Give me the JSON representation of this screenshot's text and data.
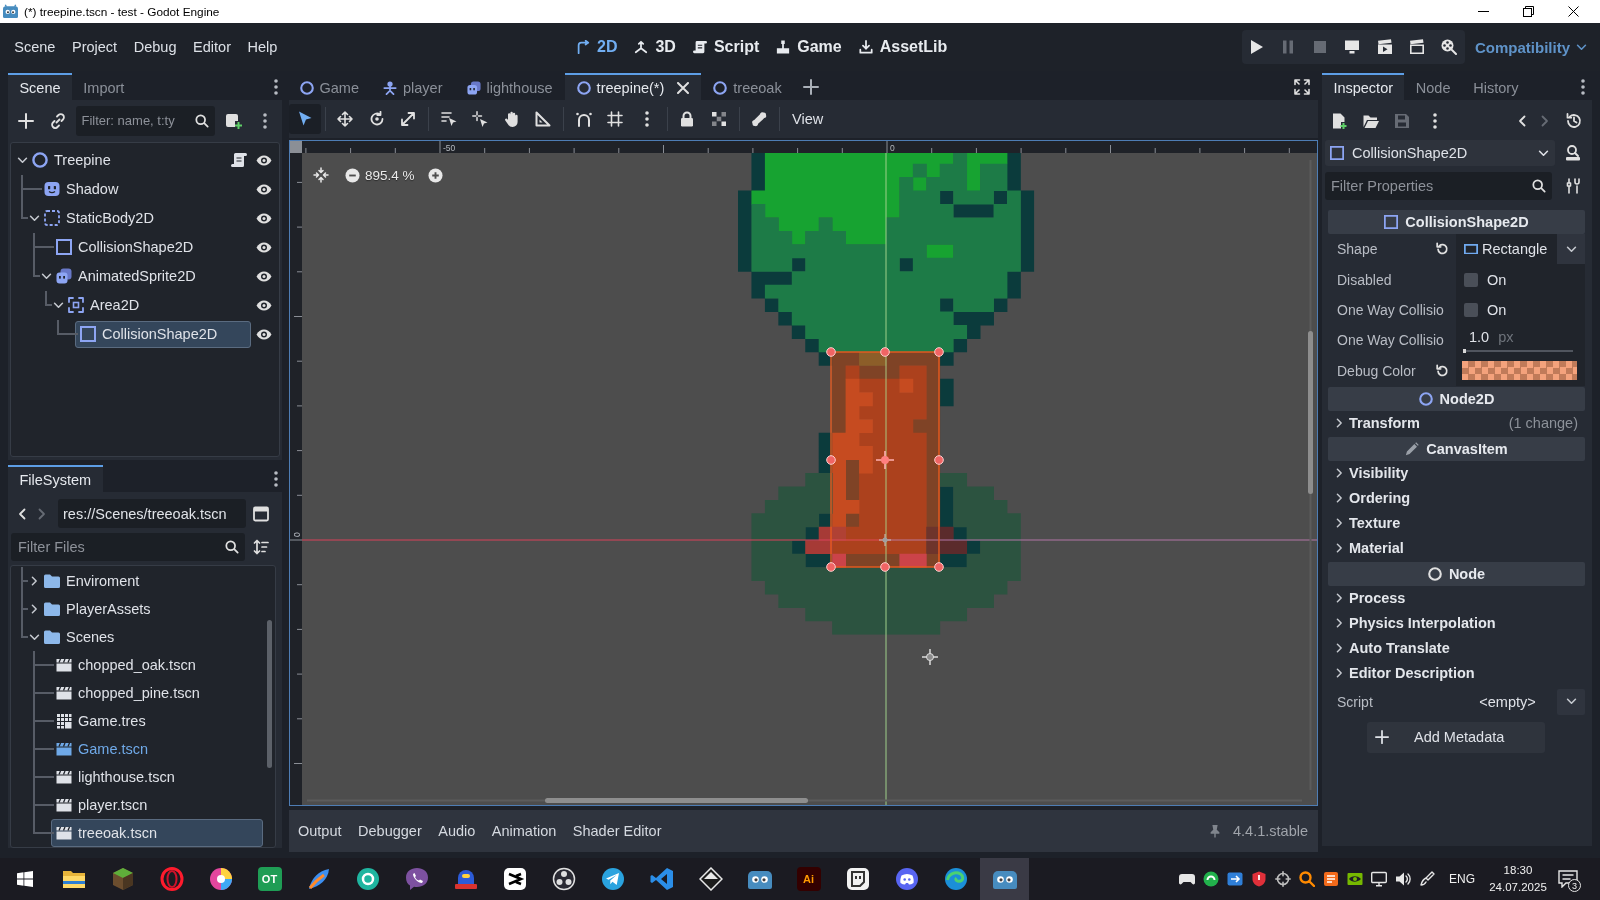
{
  "window": {
    "title": "(*) treepine.tscn - test - Godot Engine"
  },
  "menu": [
    "Scene",
    "Project",
    "Debug",
    "Editor",
    "Help"
  ],
  "workspaces": [
    {
      "label": "2D",
      "selected": true
    },
    {
      "label": "3D",
      "selected": false
    },
    {
      "label": "Script",
      "selected": false
    },
    {
      "label": "Game",
      "selected": false
    },
    {
      "label": "AssetLib",
      "selected": false
    }
  ],
  "run_buttons": [
    {
      "disabled": false
    },
    {
      "disabled": true
    },
    {
      "disabled": true
    },
    {
      "disabled": false
    },
    {
      "disabled": false
    },
    {
      "disabled": false
    },
    {
      "disabled": false
    }
  ],
  "renderer": {
    "label": "Compatibility"
  },
  "scene_dock": {
    "tabs": [
      {
        "label": "Scene",
        "selected": true
      },
      {
        "label": "Import",
        "selected": false
      }
    ],
    "filter": {
      "placeholder": "Filter: name, t:ty"
    },
    "tree": [
      {
        "name": "Treepine",
        "kind": "node2d",
        "expanded": true,
        "selected": false,
        "has_script": true,
        "visible": true,
        "children": [
          {
            "name": "Shadow",
            "kind": "sprite",
            "selected": false,
            "has_script": false,
            "visible": true
          },
          {
            "name": "StaticBody2D",
            "kind": "body",
            "expanded": true,
            "selected": false,
            "has_script": false,
            "visible": true,
            "children": [
              {
                "name": "CollisionShape2D",
                "kind": "shape",
                "selected": false,
                "has_script": false,
                "visible": true
              },
              {
                "name": "AnimatedSprite2D",
                "kind": "animated",
                "expanded": true,
                "selected": false,
                "has_script": false,
                "visible": true,
                "children": [
                  {
                    "name": "Area2D",
                    "kind": "area",
                    "expanded": true,
                    "selected": false,
                    "has_script": false,
                    "visible": true,
                    "children": [
                      {
                        "name": "CollisionShape2D",
                        "kind": "shape",
                        "selected": true,
                        "has_script": false,
                        "visible": true
                      }
                    ]
                  }
                ]
              }
            ]
          }
        ]
      }
    ]
  },
  "filesystem": {
    "tabs": [
      {
        "label": "FileSystem",
        "selected": true
      }
    ],
    "nav": [
      {
        "disabled": false
      },
      {
        "disabled": true
      }
    ],
    "path": "res://Scenes/treeoak.tscn",
    "filter": {
      "placeholder": "Filter Files"
    },
    "items": [
      {
        "name": "Enviroment",
        "kind": "folder",
        "expanded": false,
        "selected": false,
        "highlighted": false
      },
      {
        "name": "PlayerAssets",
        "kind": "folder",
        "expanded": false,
        "selected": false,
        "highlighted": false
      },
      {
        "name": "Scenes",
        "kind": "folder",
        "expanded": true,
        "selected": false,
        "highlighted": false,
        "children": [
          {
            "name": "chopped_oak.tscn",
            "kind": "scene",
            "selected": false,
            "highlighted": false
          },
          {
            "name": "chopped_pine.tscn",
            "kind": "scene",
            "selected": false,
            "highlighted": false
          },
          {
            "name": "Game.tres",
            "kind": "resource",
            "selected": false,
            "highlighted": false
          },
          {
            "name": "Game.tscn",
            "kind": "scene",
            "selected": false,
            "highlighted": true
          },
          {
            "name": "lighthouse.tscn",
            "kind": "scene",
            "selected": false,
            "highlighted": false
          },
          {
            "name": "player.tscn",
            "kind": "scene",
            "selected": false,
            "highlighted": false
          },
          {
            "name": "treeoak.tscn",
            "kind": "scene",
            "selected": true,
            "highlighted": false
          }
        ]
      }
    ]
  },
  "editor_tabs": [
    {
      "label": "Game",
      "kind": "node2d",
      "selected": false
    },
    {
      "label": "player",
      "kind": "character",
      "selected": false
    },
    {
      "label": "lighthouse",
      "kind": "animated",
      "selected": false
    },
    {
      "label": "treepine(*)",
      "kind": "node2d",
      "selected": true
    },
    {
      "label": "treeoak",
      "kind": "node2d",
      "selected": false
    }
  ],
  "canvas_toolbar": {
    "tools": [
      {
        "selected": true
      },
      {
        "selected": false
      },
      {
        "selected": false
      },
      {
        "selected": false
      },
      {
        "selected": false
      },
      {
        "selected": false
      },
      {
        "selected": false
      },
      {
        "selected": false
      },
      {
        "selected": false
      },
      {
        "selected": false
      },
      {
        "selected": false
      },
      {
        "selected": false
      },
      {
        "selected": false
      }
    ],
    "view_menu": "View"
  },
  "canvas": {
    "zoom": "895.4 %",
    "top_ruler": [
      "-50",
      "0"
    ],
    "left_ruler": [
      "0"
    ]
  },
  "bottom_panel": {
    "tabs": [
      "Output",
      "Debugger",
      "Audio",
      "Animation",
      "Shader Editor"
    ],
    "version": "4.4.1.stable"
  },
  "inspector": {
    "tabs": [
      {
        "label": "Inspector",
        "selected": true
      },
      {
        "label": "Node",
        "selected": false
      },
      {
        "label": "History",
        "selected": false
      }
    ],
    "toolbar": [
      {
        "disabled": false
      },
      {
        "disabled": false
      },
      {
        "disabled": true
      },
      {
        "disabled": false
      },
      {
        "disabled": false
      },
      {
        "disabled": true
      },
      {
        "disabled": false
      }
    ],
    "object": "CollisionShape2D",
    "filter": {
      "placeholder": "Filter Properties"
    },
    "sections": [
      {
        "title": "CollisionShape2D",
        "properties": [
          {
            "kind": "resource",
            "label": "Shape",
            "revertable": true,
            "value": "Rectangle"
          },
          {
            "kind": "checkbox",
            "label": "Disabled",
            "revertable": false,
            "checked": false,
            "text": "On"
          },
          {
            "kind": "checkbox",
            "label": "One Way Collisio",
            "revertable": false,
            "checked": false,
            "text": "On"
          },
          {
            "kind": "slider",
            "label": "One Way Collisio",
            "revertable": false,
            "value": "1.0",
            "unit": "px",
            "level": 0.03
          },
          {
            "kind": "color",
            "label": "Debug Color",
            "revertable": true,
            "color": "#f4a27c"
          }
        ]
      },
      {
        "title": "Node2D",
        "groups": [
          {
            "label": "Transform",
            "expanded": false,
            "note": "(1 change)"
          }
        ]
      },
      {
        "title": "CanvasItem",
        "groups": [
          {
            "label": "Visibility",
            "expanded": false
          },
          {
            "label": "Ordering",
            "expanded": false
          },
          {
            "label": "Texture",
            "expanded": false
          },
          {
            "label": "Material",
            "expanded": false
          }
        ]
      },
      {
        "title": "Node",
        "groups": [
          {
            "label": "Process",
            "expanded": false
          },
          {
            "label": "Physics Interpolation",
            "expanded": false
          },
          {
            "label": "Auto Translate",
            "expanded": false
          },
          {
            "label": "Editor Description",
            "expanded": false
          }
        ]
      }
    ],
    "script": {
      "label": "Script",
      "value": "<empty>"
    },
    "add_metadata": "Add Metadata"
  },
  "taskbar": {
    "apps": [
      {
        "selected": false
      },
      {
        "selected": false
      },
      {
        "selected": false
      },
      {
        "selected": false
      },
      {
        "selected": false,
        "logo": "OT"
      },
      {
        "selected": false
      },
      {
        "selected": false
      },
      {
        "selected": false
      },
      {
        "selected": false
      },
      {
        "selected": false
      },
      {
        "selected": false
      },
      {
        "selected": false
      },
      {
        "selected": false
      },
      {
        "selected": false
      },
      {
        "selected": false
      },
      {
        "selected": false,
        "logo": "Ai"
      },
      {
        "selected": false
      },
      {
        "selected": false
      },
      {
        "selected": false
      },
      {
        "selected": true
      }
    ],
    "tray": {
      "language": "ENG",
      "time": "18:30",
      "date": "24.07.2025",
      "notifications": "3"
    }
  }
}
